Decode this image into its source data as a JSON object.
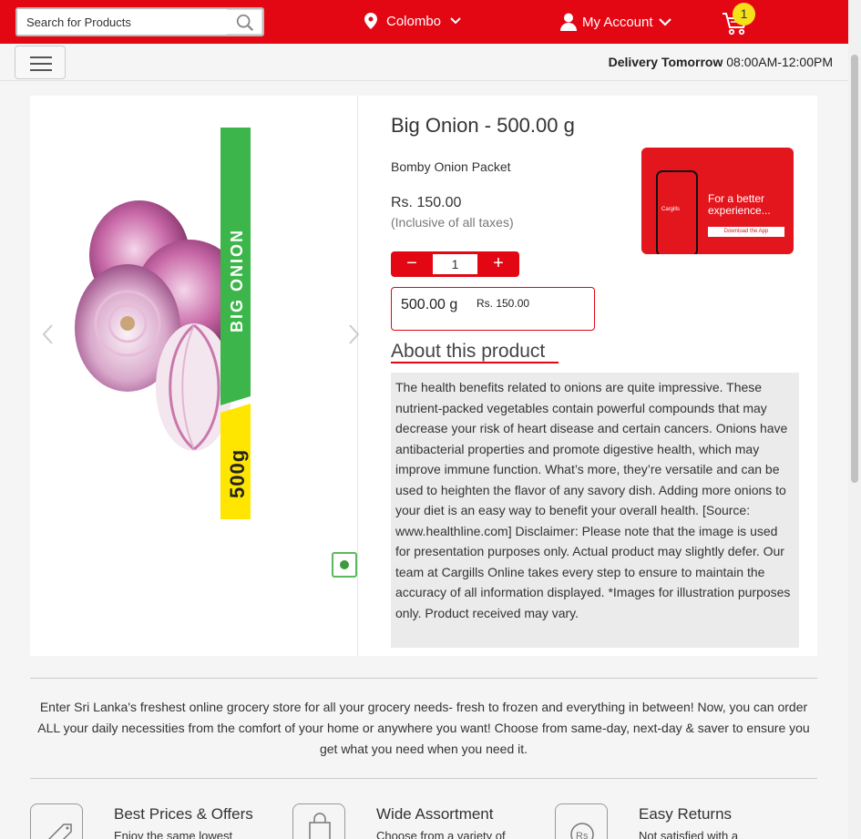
{
  "header": {
    "search_placeholder": "Search for Products",
    "location": "Colombo",
    "account_label": "My Account",
    "cart_count": "1"
  },
  "subbar": {
    "delivery_label": "Delivery Tomorrow",
    "delivery_time": "08:00AM-12:00PM"
  },
  "product": {
    "title": "Big Onion - 500.00 g",
    "subtitle": "Bomby Onion Packet",
    "price": "Rs. 150.00",
    "taxes_note": "(Inclusive of all taxes)",
    "quantity": "1",
    "variant_weight": "500.00 g",
    "variant_price": "Rs. 150.00",
    "image_label_name": "BIG ONION",
    "image_label_weight": "500g",
    "about_heading": "About this product",
    "description": "The health benefits related to onions are quite impressive. These nutrient-packed vegetables contain powerful compounds that may decrease your risk of heart disease and certain cancers. Onions have antibacterial properties and promote digestive health, which may improve immune function. What’s more, they’re versatile and can be used to heighten the flavor of any savory dish. Adding more onions to your diet is an easy way to benefit your overall health. [Source: www.healthline.com] Disclaimer: Please note that the image is used for presentation purposes only. Actual product may slightly defer. Our team at Cargills Online takes every step to ensure to maintain the accuracy of all information displayed. *Images for illustration purposes only. Product received may vary."
  },
  "promo": {
    "text": "For a better experience...",
    "download_label": "Download the App",
    "phone_logo": "Cargills"
  },
  "blurb": "Enter Sri Lanka's freshest online grocery store for all your grocery needs- fresh to frozen and everything in between! Now, you can order ALL your daily necessities from the comfort of your home or anywhere you want! Choose from same-day, next-day & saver to ensure you get what you need when you need it.",
  "features": [
    {
      "title": "Best Prices & Offers",
      "desc": "Enjoy the same lowest",
      "icon": "price-tag-icon"
    },
    {
      "title": "Wide Assortment",
      "desc": "Choose from a variety of",
      "icon": "shopping-bag-icon"
    },
    {
      "title": "Easy Returns",
      "desc": "Not satisfied with a",
      "icon": "rupee-return-icon"
    }
  ],
  "colors": {
    "brand_red": "#e30613",
    "badge_yellow": "#f5e11a",
    "label_green": "#3cb54a",
    "label_yellow": "#ffe600"
  }
}
